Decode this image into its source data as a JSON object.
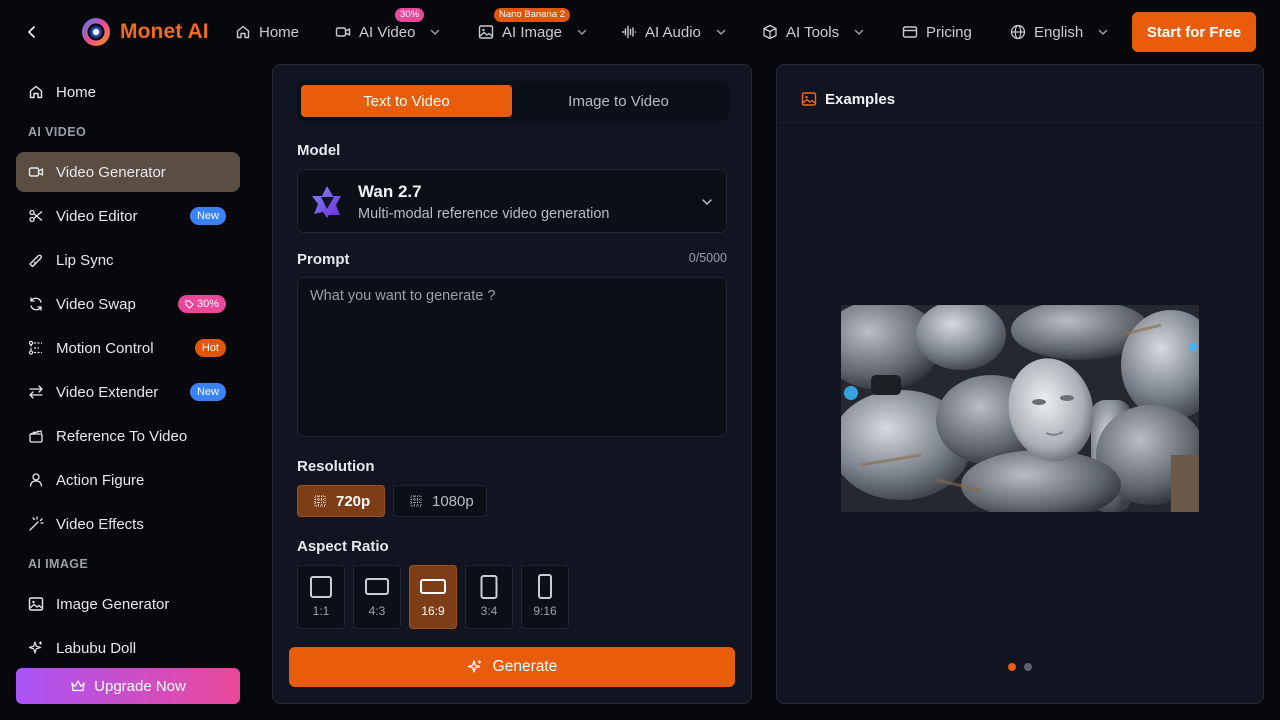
{
  "topbar": {
    "brand_name": "Monet AI",
    "nav": [
      {
        "label": "Home",
        "icon": "home-icon"
      },
      {
        "label": "AI Video",
        "icon": "video-icon",
        "badge": "30%"
      },
      {
        "label": "AI Image",
        "icon": "image-icon",
        "badge": "Nano Banana 2"
      },
      {
        "label": "AI Audio",
        "icon": "audio-wave-icon"
      },
      {
        "label": "AI Tools",
        "icon": "cube-icon"
      },
      {
        "label": "Pricing",
        "icon": "card-icon"
      },
      {
        "label": "English",
        "icon": "globe-icon"
      }
    ],
    "start_button": "Start for Free"
  },
  "sidebar": {
    "items": [
      {
        "label": "Home",
        "icon": "home-icon"
      },
      {
        "label": "Video Generator",
        "icon": "video-icon",
        "active": true
      },
      {
        "label": "Video Editor",
        "icon": "scissors-icon",
        "badge": "New"
      },
      {
        "label": "Lip Sync",
        "icon": "lips-icon"
      },
      {
        "label": "Video Swap",
        "icon": "swap-icon",
        "badge": "30%"
      },
      {
        "label": "Motion Control",
        "icon": "motion-icon",
        "badge": "Hot"
      },
      {
        "label": "Video Extender",
        "icon": "arrows-icon",
        "badge": "New"
      },
      {
        "label": "Reference To Video",
        "icon": "clapper-icon"
      },
      {
        "label": "Action Figure",
        "icon": "person-icon"
      },
      {
        "label": "Video Effects",
        "icon": "wand-icon"
      },
      {
        "label": "Image Generator",
        "icon": "image-icon"
      },
      {
        "label": "Labubu Doll",
        "icon": "sparkle-icon"
      }
    ],
    "sections": [
      "AI VIDEO",
      "AI IMAGE"
    ],
    "upgrade_button": "Upgrade Now"
  },
  "generator": {
    "tabs": [
      "Text to Video",
      "Image to Video"
    ],
    "active_tab": "Text to Video",
    "model_label": "Model",
    "model": {
      "name": "Wan 2.7",
      "description": "Multi-modal reference video generation"
    },
    "prompt_label": "Prompt",
    "prompt_counter": "0/5000",
    "prompt_value": "",
    "prompt_placeholder": "What you want to generate ?",
    "resolution_label": "Resolution",
    "resolutions": [
      "720p",
      "1080p"
    ],
    "selected_resolution": "720p",
    "aspect_label": "Aspect Ratio",
    "aspect_ratios": [
      "1:1",
      "4:3",
      "16:9",
      "3:4",
      "9:16"
    ],
    "selected_aspect": "16:9",
    "generate_button": "Generate"
  },
  "examples": {
    "title": "Examples",
    "slides": 2,
    "current_slide": 1
  },
  "colors": {
    "accent": "#e85d0c",
    "brand": "#f26a1f",
    "active_sidebar": "#5b4d42",
    "badge_new": "#3b82f6",
    "badge_hot": "#e0560c",
    "badge_discount": "#ec4899",
    "upgrade_gradient": [
      "#a855f7",
      "#ec4899"
    ]
  }
}
